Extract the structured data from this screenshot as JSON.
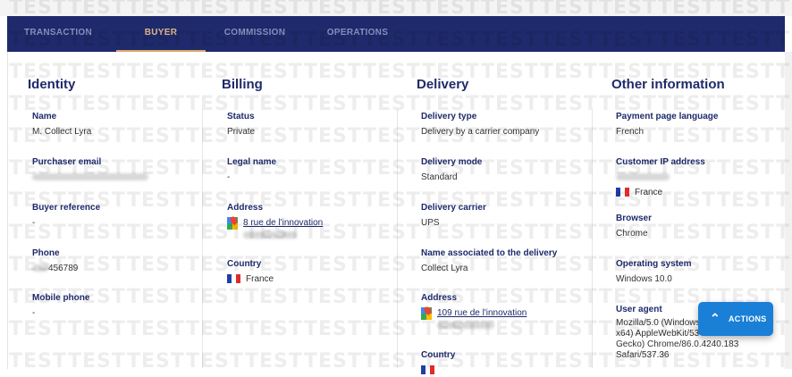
{
  "tabs": [
    {
      "label": "TRANSACTION",
      "active": false
    },
    {
      "label": "BUYER",
      "active": true
    },
    {
      "label": "COMMISSION",
      "active": false
    },
    {
      "label": "OPERATIONS",
      "active": false
    }
  ],
  "watermark_text": "TEST",
  "identity": {
    "heading": "Identity",
    "name_label": "Name",
    "name_value": "M. Collect Lyra",
    "email_label": "Purchaser email",
    "buyer_ref_label": "Buyer reference",
    "buyer_ref_value": "-",
    "phone_label": "Phone",
    "phone_value": "456789",
    "mobile_label": "Mobile phone",
    "mobile_value": "-"
  },
  "billing": {
    "heading": "Billing",
    "status_label": "Status",
    "status_value": "Private",
    "legal_label": "Legal name",
    "legal_value": "-",
    "address_label": "Address",
    "address_value": "8 rue de l'innovation",
    "country_label": "Country",
    "country_value": "France"
  },
  "delivery": {
    "heading": "Delivery",
    "type_label": "Delivery type",
    "type_value": "Delivery by a carrier company",
    "mode_label": "Delivery mode",
    "mode_value": "Standard",
    "carrier_label": "Delivery carrier",
    "carrier_value": "UPS",
    "name_label": "Name associated to the delivery",
    "name_value": "Collect Lyra",
    "address_label": "Address",
    "address_value": "109 rue de l'innovation",
    "country_label": "Country"
  },
  "other": {
    "heading": "Other information",
    "lang_label": "Payment page language",
    "lang_value": "French",
    "ip_label": "Customer IP address",
    "ip_country": "France",
    "browser_label": "Browser",
    "browser_value": "Chrome",
    "os_label": "Operating system",
    "os_value": "Windows 10.0",
    "ua_label": "User agent",
    "ua_line1": "Mozilla/5.0 (Windows",
    "ua_line2": "x64) AppleWebKit/53",
    "ua_line3": "Gecko) Chrome/86.0.4240.183",
    "ua_line4": "Safari/537.36"
  },
  "actions_label": "ACTIONS",
  "colors": {
    "navy": "#1e2a6b",
    "tab_active": "#d9a86e",
    "actions_blue": "#1a7fd6"
  }
}
